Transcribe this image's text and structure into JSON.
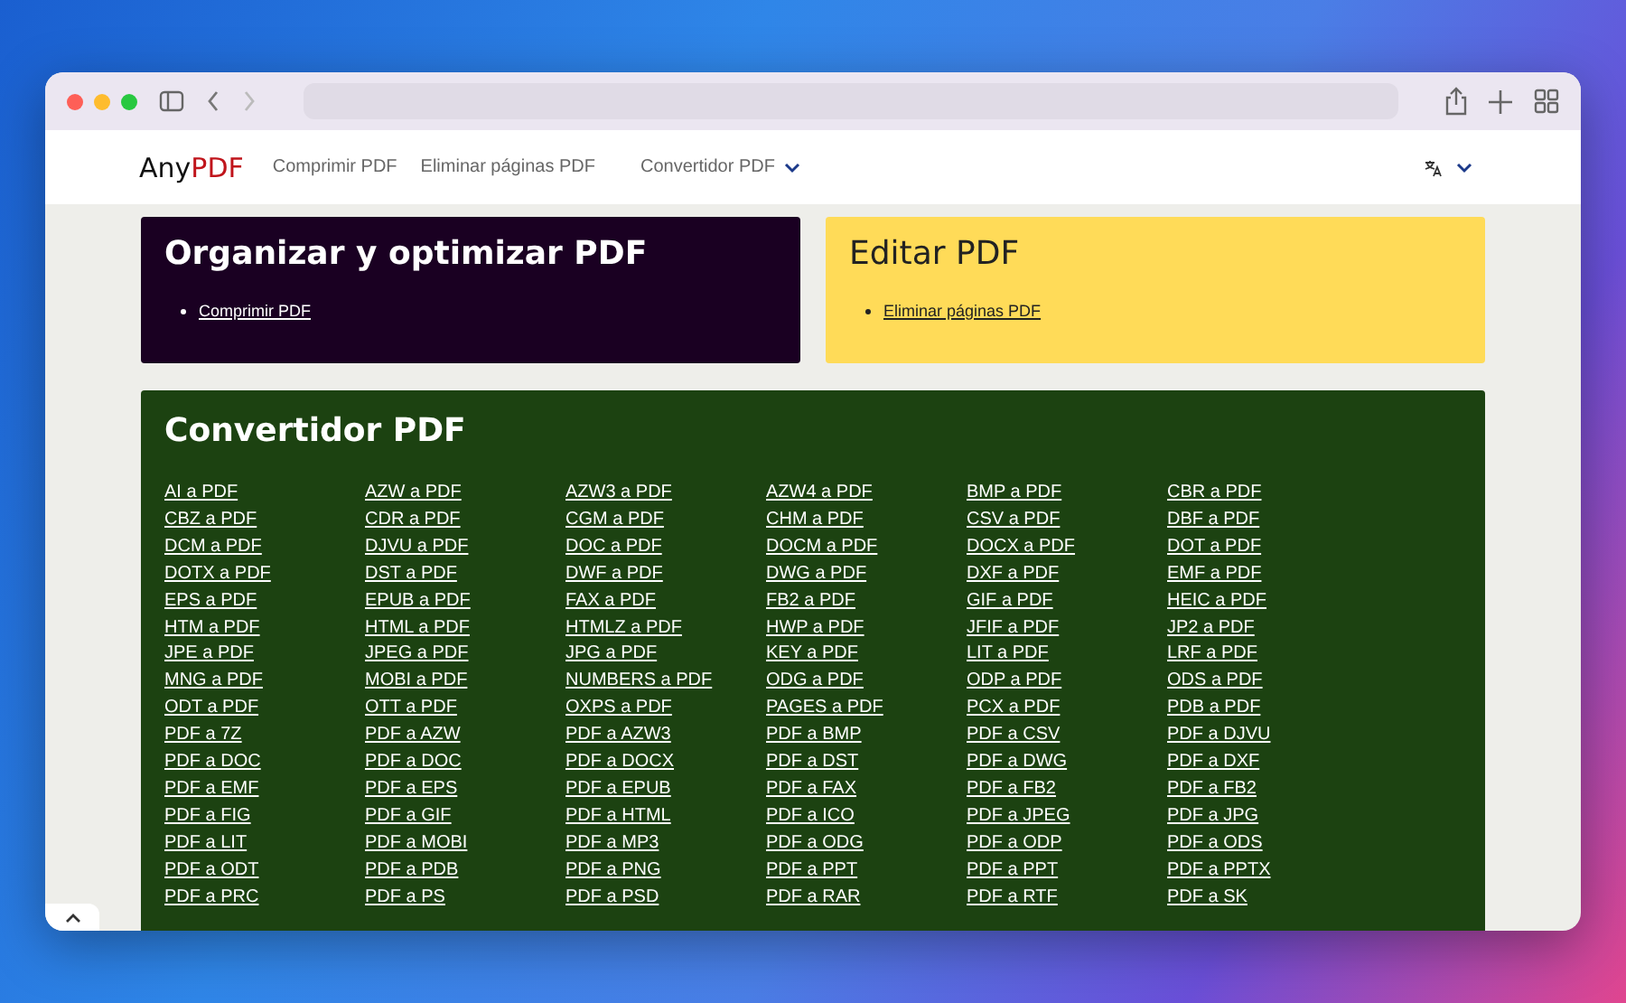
{
  "nav": {
    "logo": {
      "text": "Any",
      "accent": "PDF"
    },
    "links": [
      "Comprimir PDF",
      "Eliminar páginas PDF"
    ],
    "dropdown": {
      "label": "Convertidor PDF"
    }
  },
  "sections": [
    {
      "title": "Organizar y optimizar PDF",
      "kind": "dark",
      "links": [
        "Comprimir PDF"
      ]
    },
    {
      "title": "Editar PDF",
      "kind": "yellow",
      "links": [
        "Eliminar páginas PDF"
      ]
    }
  ],
  "converter": {
    "title": "Convertidor PDF",
    "links": [
      "AI a PDF",
      "AZW a PDF",
      "AZW3 a PDF",
      "AZW4 a PDF",
      "BMP a PDF",
      "CBR a PDF",
      "CBZ a PDF",
      "CDR a PDF",
      "CGM a PDF",
      "CHM a PDF",
      "CSV a PDF",
      "DBF a PDF",
      "DCM a PDF",
      "DJVU a PDF",
      "DOC a PDF",
      "DOCM a PDF",
      "DOCX a PDF",
      "DOT a PDF",
      "DOTX a PDF",
      "DST a PDF",
      "DWF a PDF",
      "DWG a PDF",
      "DXF a PDF",
      "EMF a PDF",
      "EPS a PDF",
      "EPUB a PDF",
      "FAX a PDF",
      "FB2 a PDF",
      "GIF a PDF",
      "HEIC a PDF",
      "HTM a PDF",
      "HTML a PDF",
      "HTMLZ a PDF",
      "HWP a PDF",
      "JFIF a PDF",
      "JP2 a PDF",
      "JPE a PDF",
      "JPEG a PDF",
      "JPG a PDF",
      "KEY a PDF",
      "LIT a PDF",
      "LRF a PDF",
      "MNG a PDF",
      "MOBI a PDF",
      "NUMBERS a PDF",
      "ODG a PDF",
      "ODP a PDF",
      "ODS a PDF",
      "ODT a PDF",
      "OTT a PDF",
      "OXPS a PDF",
      "PAGES a PDF",
      "PCX a PDF",
      "PDB a PDF",
      "PDF a 7Z",
      "PDF a AZW",
      "PDF a AZW3",
      "PDF a BMP",
      "PDF a CSV",
      "PDF a DJVU",
      "PDF a DOC",
      "PDF a DOC",
      "PDF a DOCX",
      "PDF a DST",
      "PDF a DWG",
      "PDF a DXF",
      "PDF a EMF",
      "PDF a EPS",
      "PDF a EPUB",
      "PDF a FAX",
      "PDF a FB2",
      "PDF a FB2",
      "PDF a FIG",
      "PDF a GIF",
      "PDF a HTML",
      "PDF a ICO",
      "PDF a JPEG",
      "PDF a JPG",
      "PDF a LIT",
      "PDF a MOBI",
      "PDF a MP3",
      "PDF a ODG",
      "PDF a ODP",
      "PDF a ODS",
      "PDF a ODT",
      "PDF a PDB",
      "PDF a PNG",
      "PDF a PPT",
      "PDF a PPT",
      "PDF a PPTX",
      "PDF a PRC",
      "PDF a PS",
      "PDF a PSD",
      "PDF a RAR",
      "PDF a RTF",
      "PDF a SK"
    ]
  }
}
